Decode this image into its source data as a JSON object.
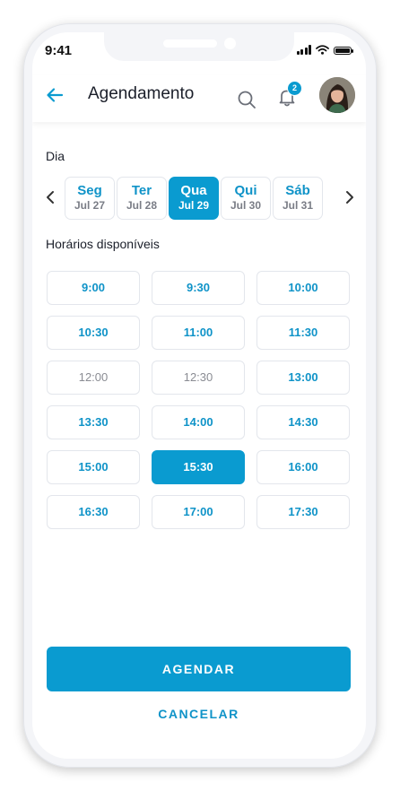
{
  "status_bar": {
    "time": "9:41",
    "icons": [
      "signal-icon",
      "wifi-icon",
      "battery-icon"
    ]
  },
  "header": {
    "title": "Agendamento",
    "back_icon": "arrow-left-icon",
    "search_icon": "search-icon",
    "bell_icon": "bell-icon",
    "notification_count": "2"
  },
  "day_section": {
    "label": "Dia",
    "days": [
      {
        "name": "Seg",
        "date": "Jul 27",
        "selected": false
      },
      {
        "name": "Ter",
        "date": "Jul 28",
        "selected": false
      },
      {
        "name": "Qua",
        "date": "Jul 29",
        "selected": true
      },
      {
        "name": "Qui",
        "date": "Jul 30",
        "selected": false
      },
      {
        "name": "Sáb",
        "date": "Jul 31",
        "selected": false
      }
    ]
  },
  "slots_section": {
    "label": "Horários disponíveis",
    "slots": [
      {
        "time": "9:00",
        "state": "available"
      },
      {
        "time": "9:30",
        "state": "available"
      },
      {
        "time": "10:00",
        "state": "available"
      },
      {
        "time": "10:30",
        "state": "available"
      },
      {
        "time": "11:00",
        "state": "available"
      },
      {
        "time": "11:30",
        "state": "available"
      },
      {
        "time": "12:00",
        "state": "unavailable"
      },
      {
        "time": "12:30",
        "state": "unavailable"
      },
      {
        "time": "13:00",
        "state": "available"
      },
      {
        "time": "13:30",
        "state": "available"
      },
      {
        "time": "14:00",
        "state": "available"
      },
      {
        "time": "14:30",
        "state": "available"
      },
      {
        "time": "15:00",
        "state": "available"
      },
      {
        "time": "15:30",
        "state": "selected"
      },
      {
        "time": "16:00",
        "state": "available"
      },
      {
        "time": "16:30",
        "state": "available"
      },
      {
        "time": "17:00",
        "state": "available"
      },
      {
        "time": "17:30",
        "state": "available"
      }
    ]
  },
  "actions": {
    "primary": "AGENDAR",
    "secondary": "CANCELAR"
  },
  "colors": {
    "accent": "#0a9bd0",
    "text": "#1b1f2a",
    "muted": "#8a8c93",
    "border": "#e3e6ec"
  }
}
